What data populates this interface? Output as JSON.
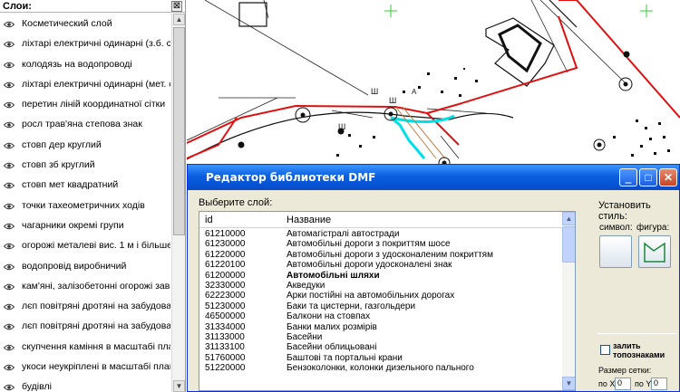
{
  "layers_panel": {
    "title": "Слои:",
    "close_glyph": "⊠",
    "items": [
      "Косметический слой",
      "ліхтарі електричні одинарні (з.б. ст",
      "колодязь на водопроводі",
      "ліхтарі електричні одинарні (мет. ст",
      "перетин ліній координатної сітки",
      "росл трав'яна степова знак",
      "стовп дер круглий",
      "стовп зб круглий",
      "стовп мет квадратний",
      "точки тахеометричних ходів",
      "чагарники окремі групи",
      "огорожі металеві вис. 1 м і більше",
      "водопровід виробничий",
      "кам'яні, залізобетонні огорожі зав",
      "лєп повітряні дротяні на забудован",
      "лєп повітряні дротяні на забудован",
      "скупчення каміння в масштабі пла",
      "укоси неукріплені в масштабі план",
      "будівлі"
    ]
  },
  "map": {
    "labels": [
      "Ш",
      "Ш",
      "А",
      "Ш"
    ]
  },
  "dialog": {
    "title": "Редактор библиотеки DMF",
    "select_layer_label": "Выберите слой:",
    "columns": {
      "id": "id",
      "name": "Название"
    },
    "rows": [
      {
        "id": "61210000",
        "name": "Автомагістралі автостради",
        "bold": false
      },
      {
        "id": "61230000",
        "name": "Автомобільні дороги з покриттям шосе",
        "bold": false
      },
      {
        "id": "61220000",
        "name": "Автомобільні дороги з удосконаленим покриттям",
        "bold": false
      },
      {
        "id": "61220100",
        "name": "Автомобільні дороги удосконалені знак",
        "bold": false
      },
      {
        "id": "61200000",
        "name": "Автомобільні шляхи",
        "bold": true
      },
      {
        "id": "32330000",
        "name": "Акведуки",
        "bold": false
      },
      {
        "id": "62223000",
        "name": "Арки постійні на автомобільних дорогах",
        "bold": false
      },
      {
        "id": "51230000",
        "name": "Баки та цистерни, газгольдери",
        "bold": false
      },
      {
        "id": "46500000",
        "name": "Балкони на стовпах",
        "bold": false
      },
      {
        "id": "31334000",
        "name": "Банки малих розмірів",
        "bold": false
      },
      {
        "id": "31133000",
        "name": "Басейни",
        "bold": false
      },
      {
        "id": "31133100",
        "name": "Басейни облицьовані",
        "bold": false
      },
      {
        "id": "51760000",
        "name": "Баштові та портальні крани",
        "bold": false
      },
      {
        "id": "51220000",
        "name": "Бензоколонки, колонки дизельного пального",
        "bold": false
      }
    ],
    "style_label": "Установить стиль:",
    "symbol_label": "символ:",
    "figure_label": "фигура:",
    "fill_label": "залить топознаками",
    "grid_size_label": "Размер сетки:",
    "grid_x_label": "по X",
    "grid_x_value": "0",
    "grid_y_label": "по Y",
    "grid_y_value": "0"
  },
  "colors": {
    "titlebar": "#0a5fde",
    "road_red": "#e01010",
    "road_cyan": "#00e0e8",
    "crosshair_green": "#33cc33"
  }
}
